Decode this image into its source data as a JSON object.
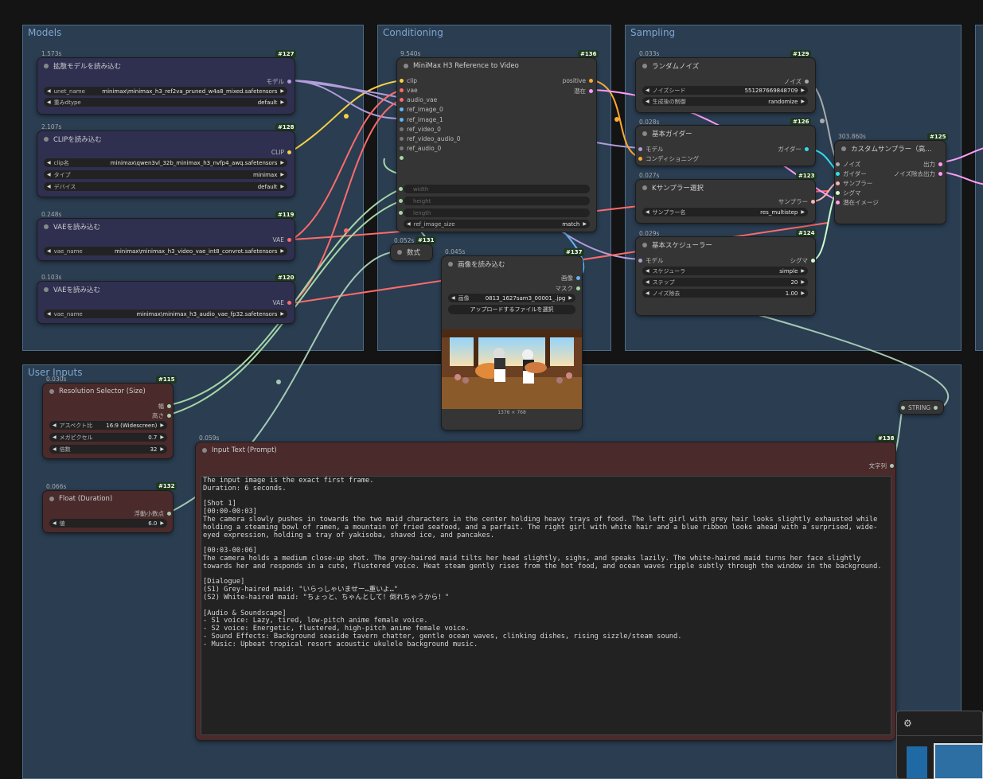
{
  "groups": {
    "models": "Models",
    "conditioning": "Conditioning",
    "sampling": "Sampling",
    "user_inputs": "User Inputs"
  },
  "nodes": {
    "unet": {
      "timing": "1.573s",
      "id": "#127",
      "title": "拡散モデルを読み込む",
      "out": "モデル",
      "w1_label": "unet_name",
      "w1_value": "minimax\\minimax_h3_ref2va_pruned_w4a8_mixed.safetensors",
      "w2_label": "重みdtype",
      "w2_value": "default"
    },
    "clip": {
      "timing": "2.107s",
      "id": "#128",
      "title": "CLIPを読み込む",
      "out": "CLIP",
      "w1_label": "clip名",
      "w1_value": "minimax\\qwen3vl_32b_minimax_h3_nvfp4_awq.safetensors",
      "w2_label": "タイプ",
      "w2_value": "minimax",
      "w3_label": "デバイス",
      "w3_value": "default"
    },
    "vae_video": {
      "timing": "0.248s",
      "id": "#119",
      "title": "VAEを読み込む",
      "out": "VAE",
      "w1_label": "vae_name",
      "w1_value": "minimax\\minimax_h3_video_vae_int8_convrot.safetensors"
    },
    "vae_audio": {
      "timing": "0.103s",
      "id": "#120",
      "title": "VAEを読み込む",
      "out": "VAE",
      "w1_label": "vae_name",
      "w1_value": "minimax\\minimax_h3_audio_vae_fp32.safetensors"
    },
    "minimax_ref": {
      "timing": "9.540s",
      "id": "#136",
      "title": "MiniMax H3 Reference to Video",
      "inputs": [
        "clip",
        "vae",
        "audio_vae",
        "ref_image_0",
        "ref_image_1",
        "ref_video_0",
        "ref_video_audio_0",
        "ref_audio_0"
      ],
      "out1": "positive",
      "out2": "潜在",
      "w_width": "width",
      "w_height": "height",
      "w_length": "length",
      "w_ref_label": "ref_image_size",
      "w_ref_value": "match"
    },
    "math": {
      "timing": "0.052s",
      "id": "#131",
      "title": "数式"
    },
    "random_noise": {
      "timing": "0.033s",
      "id": "#129",
      "title": "ランダムノイズ",
      "out": "ノイズ",
      "w1_label": "ノイズシード",
      "w1_value": "551287669848709",
      "w2_label": "生成後の制御",
      "w2_value": "randomize"
    },
    "guider": {
      "timing": "0.028s",
      "id": "#126",
      "title": "基本ガイダー",
      "in1": "モデル",
      "in2": "コンディショニング",
      "out": "ガイダー"
    },
    "ksampler_select": {
      "timing": "0.027s",
      "id": "#123",
      "title": "Kサンプラー選択",
      "out": "サンプラー",
      "w1_label": "サンプラー名",
      "w1_value": "res_multistep"
    },
    "scheduler": {
      "timing": "0.029s",
      "id": "#124",
      "title": "基本スケジューラー",
      "in1": "モデル",
      "out": "シグマ",
      "w1_label": "スケジューラ",
      "w1_value": "simple",
      "w2_label": "ステップ",
      "w2_value": "20",
      "w3_label": "ノイズ除去",
      "w3_value": "1.00"
    },
    "custom_sampler": {
      "timing": "303.860s",
      "id": "#125",
      "title": "カスタムサンプラー（高…",
      "inputs": [
        "ノイズ",
        "ガイダー",
        "サンプラー",
        "シグマ",
        "潜在イメージ"
      ],
      "out1": "出力",
      "out2": "ノイズ除去出力"
    },
    "load_image": {
      "timing": "0.045s",
      "id": "#137",
      "title": "画像を読み込む",
      "out1": "画像",
      "out2": "マスク",
      "w1_label": "画像",
      "w1_value": "0813_1627sam3_00001_.jpg",
      "upload": "アップロードするファイルを選択",
      "dims": "1376 × 768"
    },
    "resolution": {
      "timing": "0.030s",
      "id": "#115",
      "title": "Resolution Selector (Size)",
      "out1": "幅",
      "out2": "高さ",
      "w1_label": "アスペクト比",
      "w1_value": "16:9 (Widescreen)",
      "w2_label": "メガピクセル",
      "w2_value": "0.7",
      "w3_label": "倍数",
      "w3_value": "32"
    },
    "float": {
      "timing": "0.066s",
      "id": "#132",
      "title": "Float (Duration)",
      "out": "浮動小数点",
      "w1_label": "値",
      "w1_value": "6.0"
    },
    "input_text": {
      "timing": "0.059s",
      "id": "#138",
      "title": "Input Text (Prompt)",
      "out": "文字列",
      "text": "The input image is the exact first frame.\nDuration: 6 seconds.\n\n[Shot 1]\n[00:00-00:03]\nThe camera slowly pushes in towards the two maid characters in the center holding heavy trays of food. The left girl with grey hair looks slightly exhausted while holding a steaming bowl of ramen, a mountain of fried seafood, and a parfait. The right girl with white hair and a blue ribbon looks ahead with a surprised, wide-eyed expression, holding a tray of yakisoba, shaved ice, and pancakes.\n\n[00:03-00:06]\nThe camera holds a medium close-up shot. The grey-haired maid tilts her head slightly, sighs, and speaks lazily. The white-haired maid turns her face slightly towards her and responds in a cute, flustered voice. Heat steam gently rises from the hot food, and ocean waves ripple subtly through the window in the background.\n\n[Dialogue]\n(S1) Grey-haired maid: \"いらっしゃいませー…重いよ…\"\n(S2) White-haired maid: \"ちょっと、ちゃんとして！倒れちゃうから！\"\n\n[Audio & Soundscape]\n- S1 voice: Lazy, tired, low-pitch anime female voice.\n- S2 voice: Energetic, flustered, high-pitch anime female voice.\n- Sound Effects: Background seaside tavern chatter, gentle ocean waves, clinking dishes, rising sizzle/steam sound.\n- Music: Upbeat tropical resort acoustic ukulele background music."
    },
    "string_reroute": {
      "label": "STRING"
    }
  },
  "colors": {
    "group_bg": "#2a3d51",
    "clip_wire": "#f5d142",
    "vae_wire": "#ff6b6b",
    "model_wire": "#b39ddb",
    "cond_wire": "#ffa931",
    "latent_wire": "#ff9cf9",
    "float_wire": "#a5c9b5",
    "int_wire": "#a5d6a7"
  }
}
